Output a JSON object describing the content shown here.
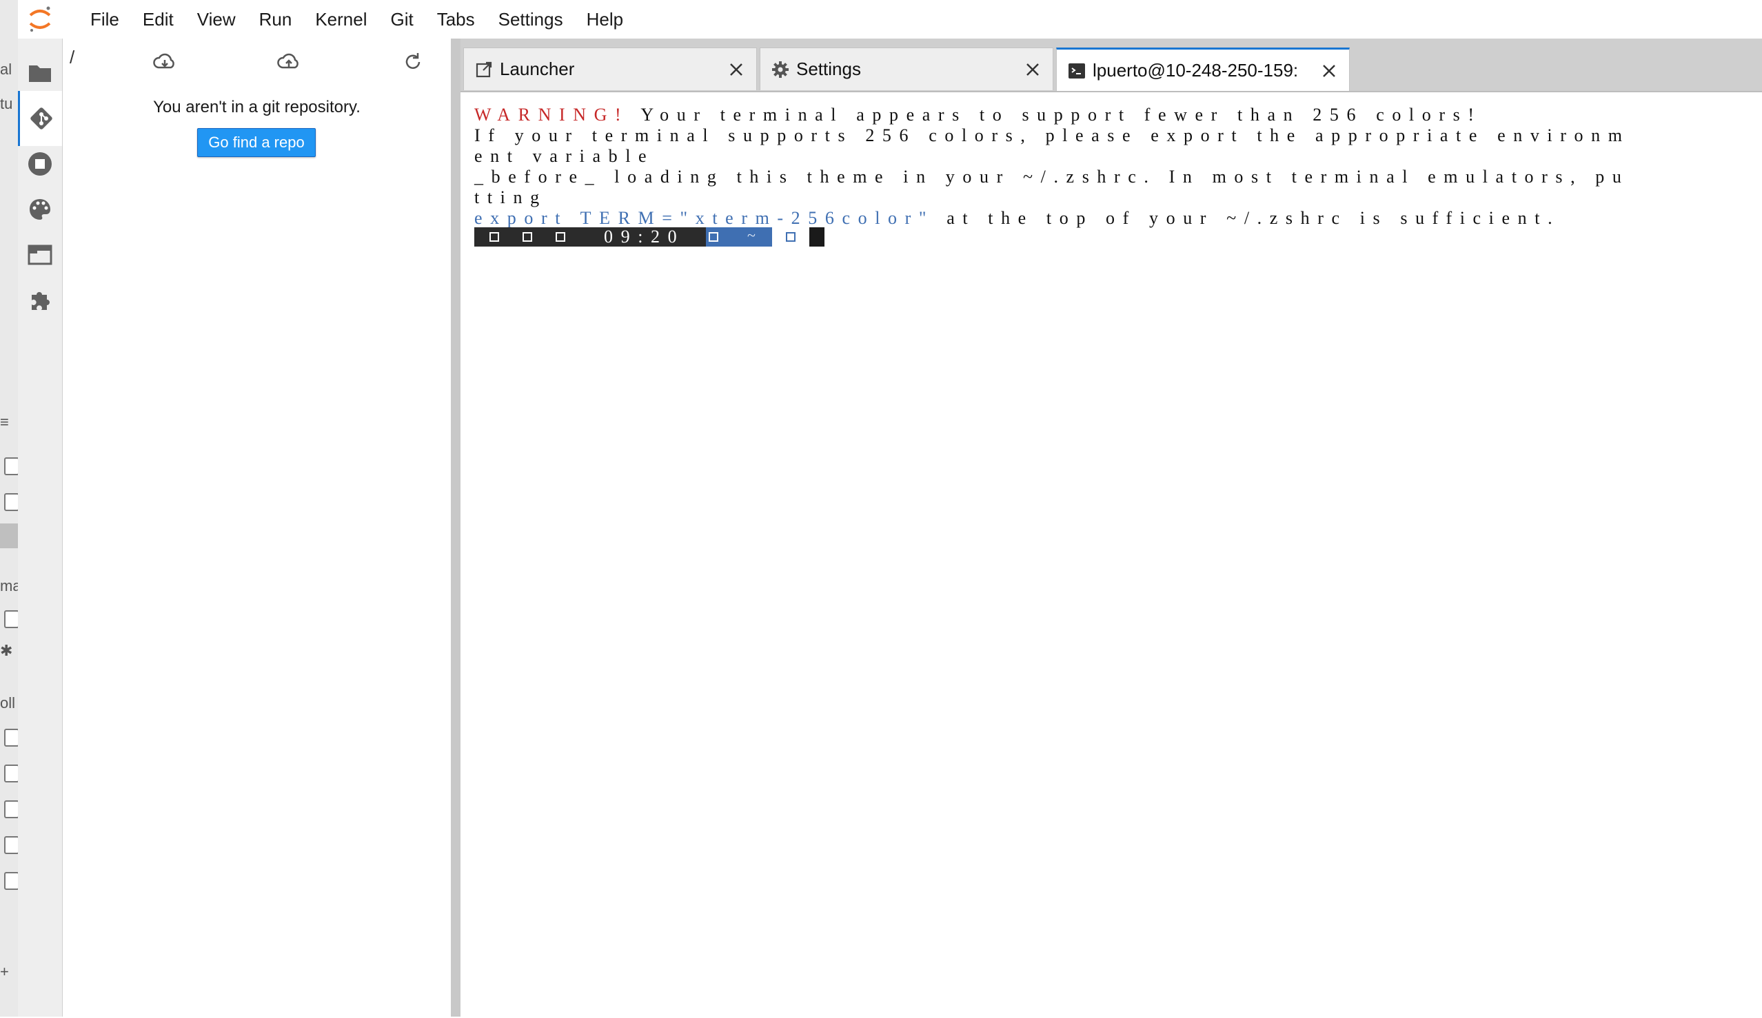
{
  "menubar": {
    "items": [
      "File",
      "Edit",
      "View",
      "Run",
      "Kernel",
      "Git",
      "Tabs",
      "Settings",
      "Help"
    ]
  },
  "activity_bar": {
    "icons": [
      "folder-icon",
      "git-icon",
      "stop-circle-icon",
      "palette-icon",
      "tabs-icon",
      "extension-puzzle-icon"
    ]
  },
  "git_panel": {
    "path": "/",
    "message": "You aren't in a git repository.",
    "find_repo_button": "Go find a repo"
  },
  "tabs": [
    {
      "label": "Launcher",
      "icon": "launcher-icon",
      "active": false
    },
    {
      "label": "Settings",
      "icon": "gear-icon",
      "active": false
    },
    {
      "label": "lpuerto@10-248-250-159:",
      "icon": "terminal-icon",
      "active": true
    }
  ],
  "terminal": {
    "lines": [
      {
        "warning": "WARNING!",
        "text": " Your terminal appears to support fewer than 256 colors!"
      },
      {
        "text": "If your terminal supports 256 colors, please export the appropriate environm"
      },
      {
        "text": "ent variable"
      },
      {
        "text": "_before_ loading this theme in your ~/.zshrc. In most terminal emulators, pu"
      },
      {
        "text": "tting"
      },
      {
        "export": "export TERM=\"xterm-256color\"",
        "text": " at the top of your ~/.zshrc is sufficient."
      }
    ],
    "prompt": {
      "time": "09:20",
      "dir": "~"
    }
  },
  "colors": {
    "accent": "#1976d2",
    "button": "#2196f3",
    "warning_text": "#c62828",
    "prompt_blue": "#3f6fb2",
    "prompt_dark": "#2b2b2b"
  }
}
